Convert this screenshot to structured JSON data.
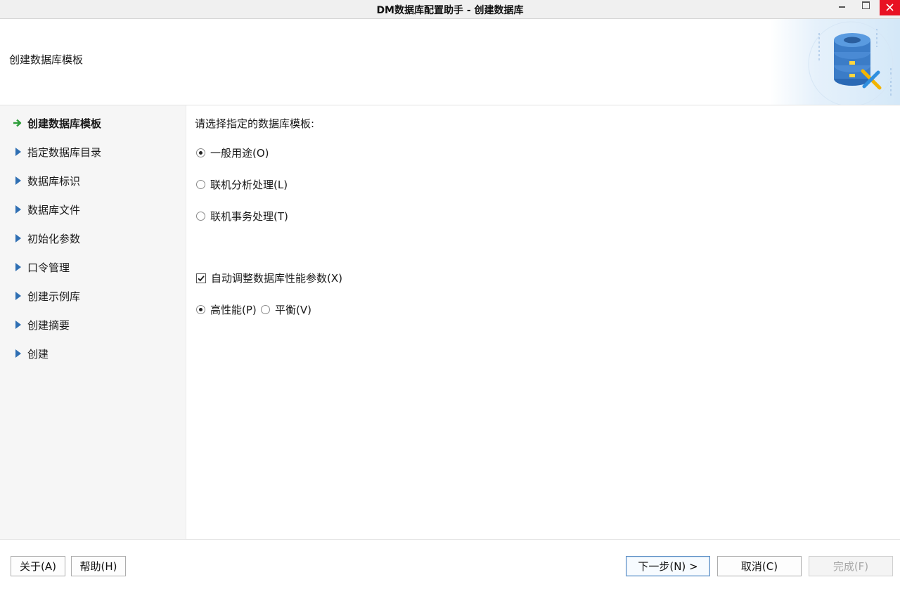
{
  "window": {
    "title": "DM数据库配置助手 - 创建数据库",
    "controls": {
      "minimize": "minimize-icon",
      "maximize": "maximize-icon",
      "close": "close-icon"
    }
  },
  "header": {
    "subtitle": "创建数据库模板",
    "banner_icon": "database-wrench-icon"
  },
  "sidebar": {
    "steps": [
      {
        "label": "创建数据库模板",
        "active": true,
        "icon": "green-arrow-icon"
      },
      {
        "label": "指定数据库目录",
        "active": false,
        "icon": "triangle-right-icon"
      },
      {
        "label": "数据库标识",
        "active": false,
        "icon": "triangle-right-icon"
      },
      {
        "label": "数据库文件",
        "active": false,
        "icon": "triangle-right-icon"
      },
      {
        "label": "初始化参数",
        "active": false,
        "icon": "triangle-right-icon"
      },
      {
        "label": "口令管理",
        "active": false,
        "icon": "triangle-right-icon"
      },
      {
        "label": "创建示例库",
        "active": false,
        "icon": "triangle-right-icon"
      },
      {
        "label": "创建摘要",
        "active": false,
        "icon": "triangle-right-icon"
      },
      {
        "label": "创建",
        "active": false,
        "icon": "triangle-right-icon"
      }
    ]
  },
  "main": {
    "prompt": "请选择指定的数据库模板:",
    "templates": [
      {
        "label": "一般用途(O)",
        "selected": true
      },
      {
        "label": "联机分析处理(L)",
        "selected": false
      },
      {
        "label": "联机事务处理(T)",
        "selected": false
      }
    ],
    "auto_tune": {
      "label": "自动调整数据库性能参数(X)",
      "checked": true
    },
    "tune_modes": [
      {
        "label": "高性能(P)",
        "selected": true
      },
      {
        "label": "平衡(V)",
        "selected": false
      }
    ]
  },
  "footer": {
    "about": "关于(A)",
    "help": "帮助(H)",
    "next": "下一步(N) >",
    "cancel": "取消(C)",
    "finish": "完成(F)"
  },
  "colors": {
    "accent": "#2f6fb3",
    "active_arrow": "#2e9e3a",
    "close_button": "#e81123"
  }
}
